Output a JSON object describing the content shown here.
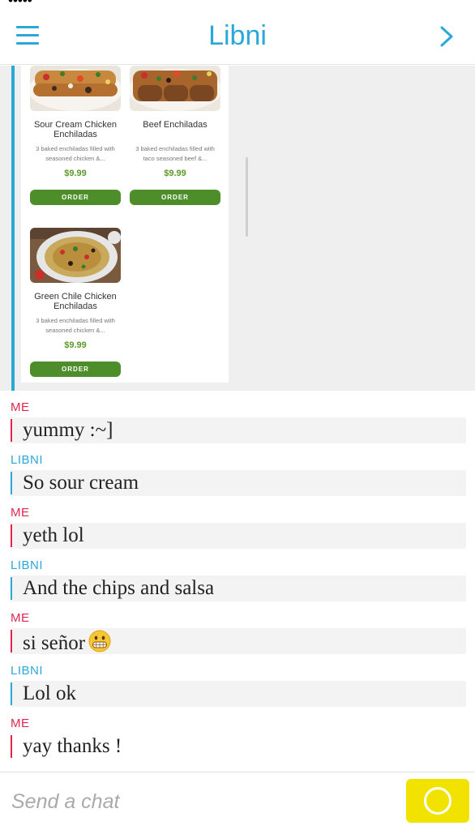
{
  "header": {
    "title": "Libni"
  },
  "menu_items": [
    {
      "name": "Sour Cream Chicken Enchiladas",
      "description": "3 baked enchiladas filled with seasoned chicken &...",
      "price": "$9.99",
      "button": "ORDER"
    },
    {
      "name": "Beef Enchiladas",
      "description": "3 baked enchiladas filled with taco seasoned beef &...",
      "price": "$9.99",
      "button": "ORDER"
    },
    {
      "name": "Green Chile Chicken Enchiladas",
      "description": "3 baked enchiladas filled with seasoned chicken &...",
      "price": "$9.99",
      "button": "ORDER"
    }
  ],
  "messages": [
    {
      "sender": "ME",
      "text": "yummy :~]"
    },
    {
      "sender": "LIBNI",
      "text": "So sour cream"
    },
    {
      "sender": "ME",
      "text": "yeth lol"
    },
    {
      "sender": "LIBNI",
      "text": "And the chips and salsa"
    },
    {
      "sender": "ME",
      "text": "si señor"
    },
    {
      "sender": "LIBNI",
      "text": "Lol ok"
    },
    {
      "sender": "ME",
      "text": "yay thanks !"
    }
  ],
  "emoji_icon": "grimacing-face-icon",
  "input": {
    "placeholder": "Send a chat"
  },
  "colors": {
    "accent_blue": "#2aa8d8",
    "me_red": "#e0264e",
    "order_green": "#4e8e2a",
    "price_green": "#5a9a2a",
    "send_yellow": "#f2e200"
  }
}
